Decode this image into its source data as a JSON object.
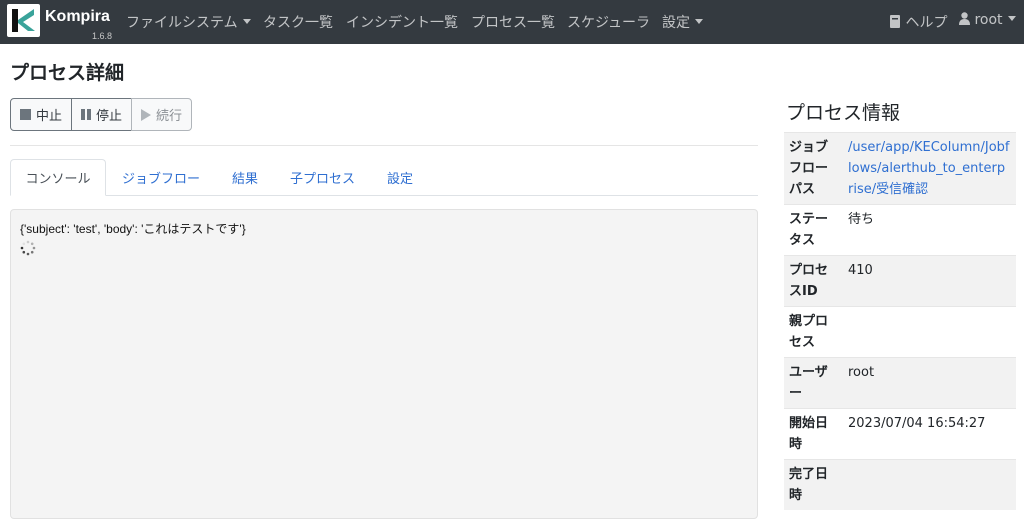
{
  "navbar": {
    "brand": "Kompira",
    "version": "1.6.8",
    "menu": [
      "ファイルシステム",
      "タスク一覧",
      "インシデント一覧",
      "プロセス一覧",
      "スケジューラ",
      "設定"
    ],
    "help": "ヘルプ",
    "user": "root"
  },
  "page": {
    "title": "プロセス詳細"
  },
  "buttons": {
    "abort": "中止",
    "stop": "停止",
    "resume": "続行"
  },
  "tabs": [
    "コンソール",
    "ジョブフロー",
    "結果",
    "子プロセス",
    "設定"
  ],
  "console": {
    "output": "{'subject': 'test', 'body': 'これはテストです'}"
  },
  "info": {
    "title": "プロセス情報",
    "rows": [
      {
        "key": "ジョブフローパス",
        "value": "/user/app/KEColumn/Jobflows/alerthub_to_enterprise/受信確認"
      },
      {
        "key": "ステータス",
        "value": "待ち"
      },
      {
        "key": "プロセスID",
        "value": "410"
      },
      {
        "key": "親プロセス",
        "value": ""
      },
      {
        "key": "ユーザー",
        "value": "root"
      },
      {
        "key": "開始日時",
        "value": "2023/07/04 16:54:27"
      },
      {
        "key": "完了日時",
        "value": ""
      }
    ]
  },
  "colors": {
    "navbar": "#343a40",
    "link": "#2f6fd1",
    "console_bg": "#f4f4f4"
  }
}
